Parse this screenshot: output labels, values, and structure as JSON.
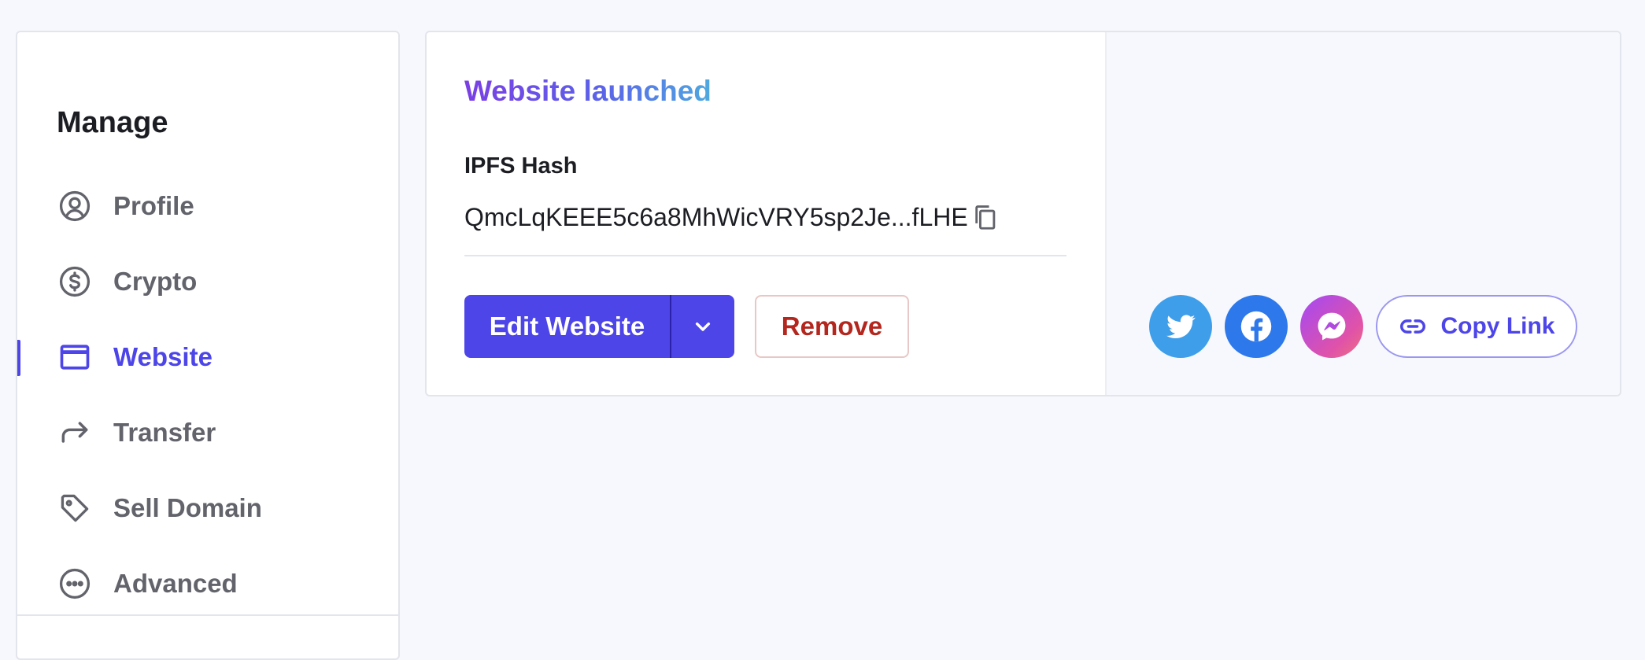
{
  "sidebar": {
    "title": "Manage",
    "items": [
      {
        "label": "Profile",
        "icon": "user-circle-icon",
        "active": false
      },
      {
        "label": "Crypto",
        "icon": "dollar-circle-icon",
        "active": false
      },
      {
        "label": "Website",
        "icon": "browser-window-icon",
        "active": true
      },
      {
        "label": "Transfer",
        "icon": "arrow-forward-icon",
        "active": false
      },
      {
        "label": "Sell Domain",
        "icon": "tag-icon",
        "active": false
      },
      {
        "label": "Advanced",
        "icon": "more-circle-icon",
        "active": false
      }
    ]
  },
  "card": {
    "title": "Website launched",
    "hash_label": "IPFS Hash",
    "hash_value": "QmcLqKEEE5c6a8MhWicVRY5sp2Je...fLHE",
    "edit_label": "Edit Website",
    "remove_label": "Remove",
    "copy_link_label": "Copy Link",
    "social": [
      "twitter-icon",
      "facebook-icon",
      "messenger-icon"
    ]
  },
  "colors": {
    "accent": "#4D45E8",
    "danger": "#B3271E",
    "twitter": "#3E9EEA",
    "facebook": "#2D78EB"
  }
}
